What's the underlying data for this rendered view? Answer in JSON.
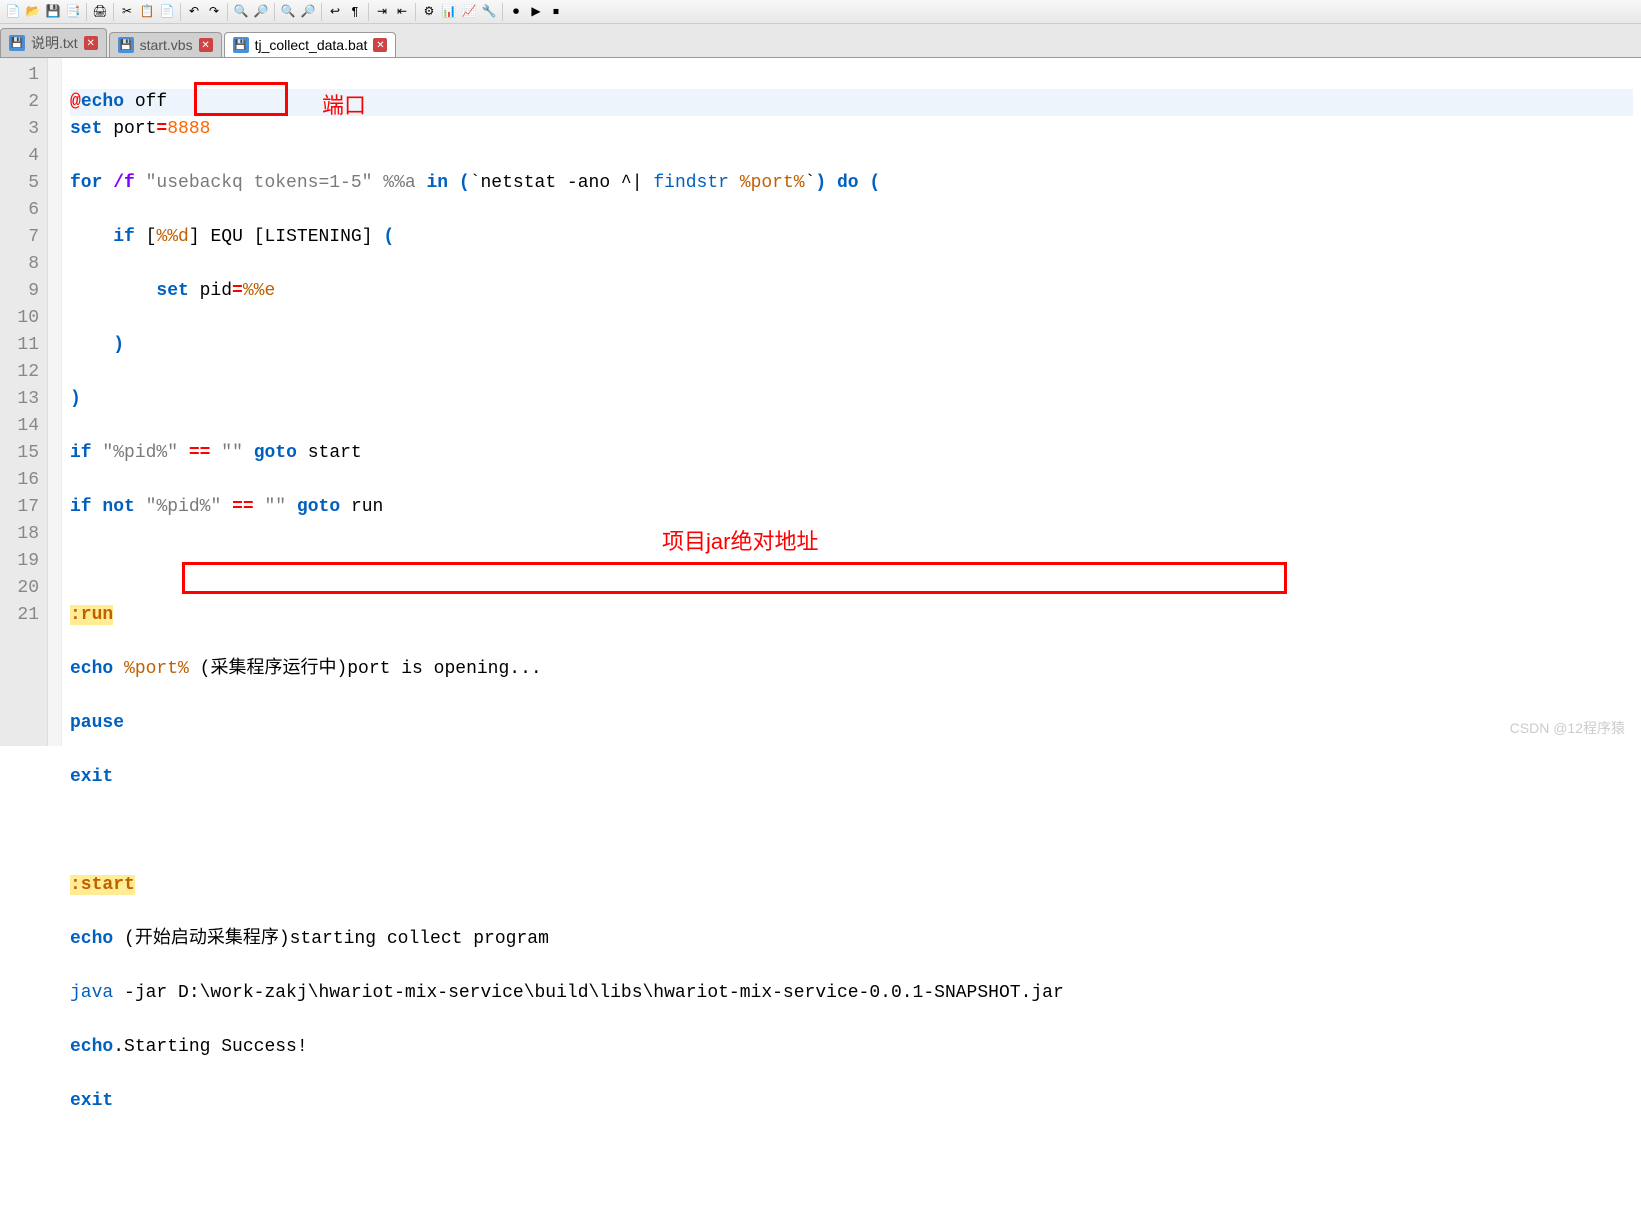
{
  "tabs": [
    {
      "label": "说明.txt",
      "active": false
    },
    {
      "label": "start.vbs",
      "active": false
    },
    {
      "label": "tj_collect_data.bat",
      "active": true
    }
  ],
  "gutter": [
    "1",
    "2",
    "3",
    "4",
    "5",
    "6",
    "7",
    "8",
    "9",
    "10",
    "11",
    "12",
    "13",
    "14",
    "15",
    "16",
    "17",
    "18",
    "19",
    "20",
    "21"
  ],
  "code": {
    "l1": {
      "at": "@",
      "echo": "echo",
      "off": " off"
    },
    "l2": {
      "set": "set",
      "port": " port",
      "eq": "=",
      "val": "8888"
    },
    "l3": {
      "for": "for",
      "f": " /f ",
      "q1": "\"usebackq tokens=1-5\"",
      "pa": " %%a ",
      "in": "in",
      "op": " (",
      "bt1": "`netstat -ano ^| ",
      "fs": "findstr ",
      "pp": "%port%",
      "bt2": "`",
      "cp": ")",
      "do": " do ",
      "op2": "("
    },
    "l4": {
      "pad": "    ",
      "if": "if",
      "sp": " ",
      "ob": "[",
      "pd": "%%d",
      "cb": "]",
      "sp2": " EQU ",
      "ob2": "[",
      "lst": "LISTENING",
      "cb2": "]",
      "sp3": " ",
      "op": "("
    },
    "l5": {
      "pad": "        ",
      "set": "set",
      "pid": " pid",
      "eq": "=",
      "pe": "%%e"
    },
    "l6": {
      "pad": "    ",
      "cp": ")"
    },
    "l7": {
      "cp": ")"
    },
    "l8": {
      "if": "if",
      "sp": " ",
      "q1": "\"%pid%\"",
      "sp2": " ",
      "eq": "==",
      "sp3": " ",
      "q2": "\"\"",
      "sp4": " ",
      "goto": "goto",
      "tgt": " start"
    },
    "l9": {
      "if": "if",
      "sp": " ",
      "not": "not",
      "sp2": " ",
      "q1": "\"%pid%\"",
      "sp3": " ",
      "eq": "==",
      "sp4": " ",
      "q2": "\"\"",
      "sp5": " ",
      "goto": "goto",
      "tgt": " run"
    },
    "l11": {
      "lbl": ":run"
    },
    "l12": {
      "echo": "echo",
      "sp": " ",
      "pp": "%port%",
      "txt": " (采集程序运行中)port is opening..."
    },
    "l13": {
      "pause": "pause"
    },
    "l14": {
      "exit": "exit"
    },
    "l16": {
      "lbl": ":start"
    },
    "l17": {
      "echo": "echo",
      "txt": " (开始启动采集程序)starting collect program"
    },
    "l18": {
      "java": "java",
      "jar": " -jar ",
      "path": "D:\\work-zakj\\hwariot-mix-service\\build\\libs\\hwariot-mix-service-0.0.1-SNAPSHOT.jar"
    },
    "l19": {
      "echo": "echo",
      "dot": ".",
      "txt": "Starting Success!"
    },
    "l20": {
      "exit": "exit"
    }
  },
  "annotations": {
    "port": "端口",
    "jarpath": "项目jar绝对地址"
  },
  "watermark": "CSDN @12程序猿"
}
